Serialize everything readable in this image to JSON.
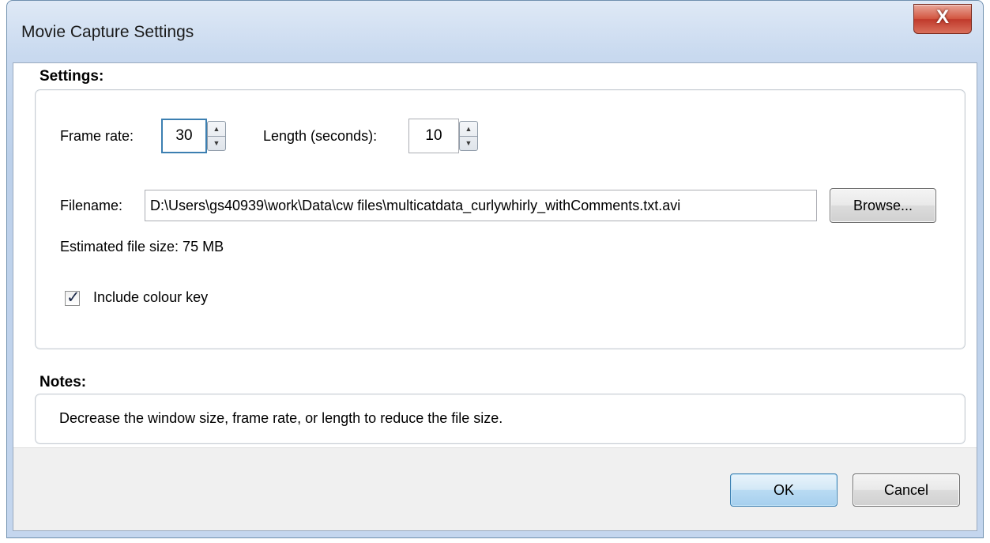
{
  "window": {
    "title": "Movie Capture Settings",
    "close_glyph": "X"
  },
  "settings": {
    "heading": "Settings:",
    "frame_rate_label": "Frame rate:",
    "frame_rate_value": "30",
    "length_label": "Length (seconds):",
    "length_value": "10",
    "filename_label": "Filename:",
    "filename_value": "D:\\Users\\gs40939\\work\\Data\\cw files\\multicatdata_curlywhirly_withComments.txt.avi",
    "browse_label": "Browse...",
    "estimated_size": "Estimated file size: 75 MB",
    "include_colour_key_label": "Include colour key",
    "include_colour_key_checked": true
  },
  "notes": {
    "heading": "Notes:",
    "text": "Decrease the window size, frame rate, or length to reduce the file size."
  },
  "buttons": {
    "ok": "OK",
    "cancel": "Cancel"
  },
  "icons": {
    "close": "close-icon",
    "spin_up": "arrow-up-icon",
    "spin_down": "arrow-down-icon",
    "check": "checkmark-icon"
  }
}
